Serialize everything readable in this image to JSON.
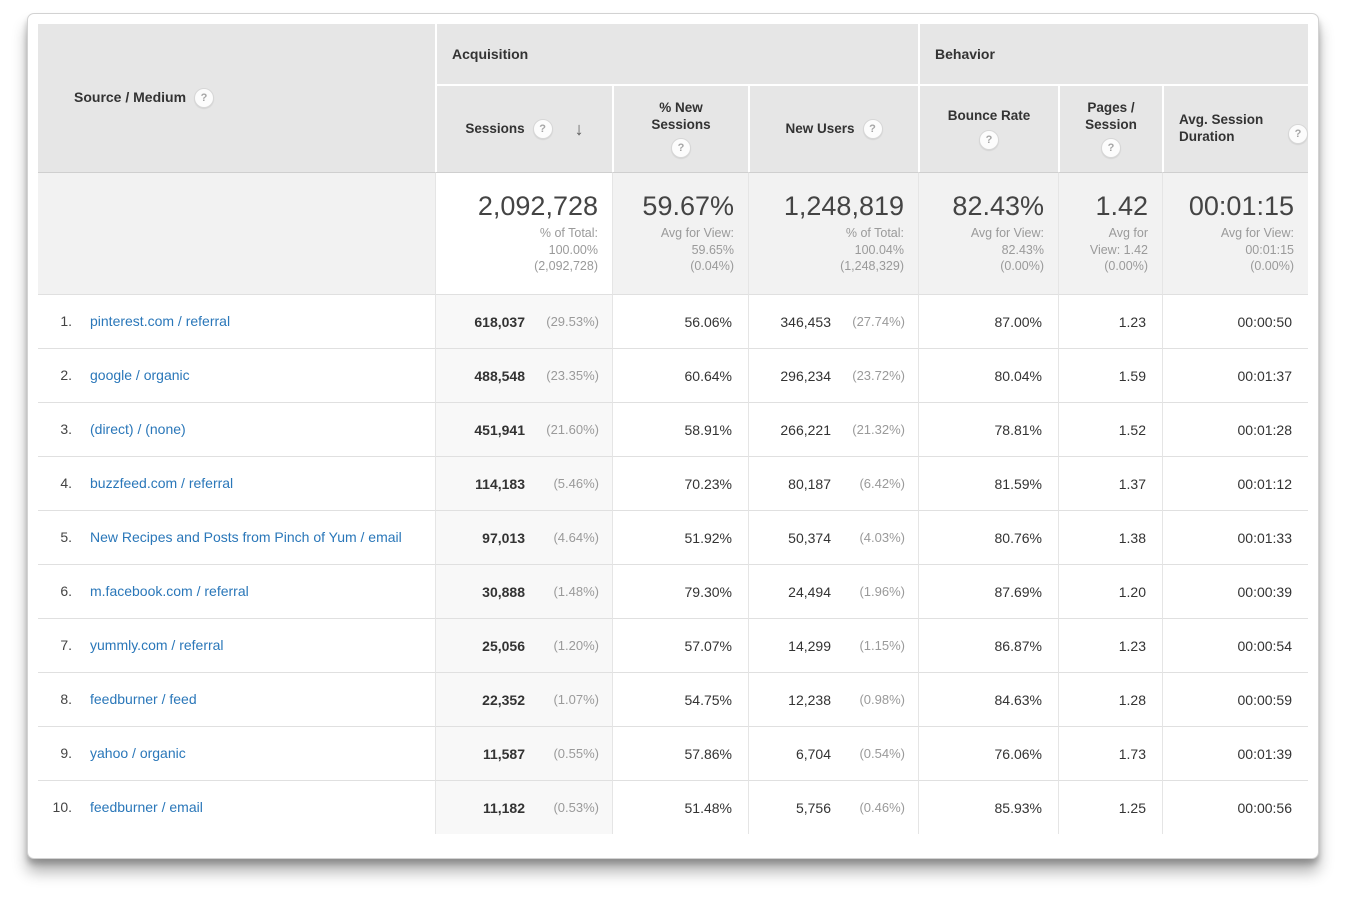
{
  "header": {
    "row_dimension": {
      "label": "Source / Medium"
    },
    "groups": [
      {
        "label": "Acquisition"
      },
      {
        "label": "Behavior"
      }
    ],
    "columns": [
      {
        "label": "Sessions",
        "sorted": "descending"
      },
      {
        "label": "% New Sessions"
      },
      {
        "label": "New Users"
      },
      {
        "label": "Bounce Rate"
      },
      {
        "label": "Pages / Session"
      },
      {
        "label": "Avg. Session Duration"
      }
    ]
  },
  "icons": {
    "help": "?",
    "sort_desc": "↓"
  },
  "summary": [
    {
      "value": "2,092,728",
      "sub": [
        "% of Total:",
        "100.00%",
        "(2,092,728)"
      ]
    },
    {
      "value": "59.67%",
      "sub": [
        "Avg for View:",
        "59.65%",
        "(0.04%)"
      ]
    },
    {
      "value": "1,248,819",
      "sub": [
        "% of Total:",
        "100.04%",
        "(1,248,329)"
      ]
    },
    {
      "value": "82.43%",
      "sub": [
        "Avg for View:",
        "82.43%",
        "(0.00%)"
      ]
    },
    {
      "value": "1.42",
      "sub": [
        "Avg for",
        "View: 1.42",
        "(0.00%)"
      ]
    },
    {
      "value": "00:01:15",
      "sub": [
        "Avg for View:",
        "00:01:15",
        "(0.00%)"
      ]
    }
  ],
  "rows": [
    {
      "rank": "1.",
      "source": "pinterest.com / referral",
      "sessions": "618,037",
      "sessions_pct": "(29.53%)",
      "new_sessions_pct": "56.06%",
      "new_users": "346,453",
      "new_users_pct": "(27.74%)",
      "bounce_rate": "87.00%",
      "pages_session": "1.23",
      "avg_duration": "00:00:50"
    },
    {
      "rank": "2.",
      "source": "google / organic",
      "sessions": "488,548",
      "sessions_pct": "(23.35%)",
      "new_sessions_pct": "60.64%",
      "new_users": "296,234",
      "new_users_pct": "(23.72%)",
      "bounce_rate": "80.04%",
      "pages_session": "1.59",
      "avg_duration": "00:01:37"
    },
    {
      "rank": "3.",
      "source": "(direct) / (none)",
      "sessions": "451,941",
      "sessions_pct": "(21.60%)",
      "new_sessions_pct": "58.91%",
      "new_users": "266,221",
      "new_users_pct": "(21.32%)",
      "bounce_rate": "78.81%",
      "pages_session": "1.52",
      "avg_duration": "00:01:28"
    },
    {
      "rank": "4.",
      "source": "buzzfeed.com / referral",
      "sessions": "114,183",
      "sessions_pct": "(5.46%)",
      "new_sessions_pct": "70.23%",
      "new_users": "80,187",
      "new_users_pct": "(6.42%)",
      "bounce_rate": "81.59%",
      "pages_session": "1.37",
      "avg_duration": "00:01:12"
    },
    {
      "rank": "5.",
      "source": "New Recipes and Posts from Pinch of Yum / email",
      "sessions": "97,013",
      "sessions_pct": "(4.64%)",
      "new_sessions_pct": "51.92%",
      "new_users": "50,374",
      "new_users_pct": "(4.03%)",
      "bounce_rate": "80.76%",
      "pages_session": "1.38",
      "avg_duration": "00:01:33"
    },
    {
      "rank": "6.",
      "source": "m.facebook.com / referral",
      "sessions": "30,888",
      "sessions_pct": "(1.48%)",
      "new_sessions_pct": "79.30%",
      "new_users": "24,494",
      "new_users_pct": "(1.96%)",
      "bounce_rate": "87.69%",
      "pages_session": "1.20",
      "avg_duration": "00:00:39"
    },
    {
      "rank": "7.",
      "source": "yummly.com / referral",
      "sessions": "25,056",
      "sessions_pct": "(1.20%)",
      "new_sessions_pct": "57.07%",
      "new_users": "14,299",
      "new_users_pct": "(1.15%)",
      "bounce_rate": "86.87%",
      "pages_session": "1.23",
      "avg_duration": "00:00:54"
    },
    {
      "rank": "8.",
      "source": "feedburner / feed",
      "sessions": "22,352",
      "sessions_pct": "(1.07%)",
      "new_sessions_pct": "54.75%",
      "new_users": "12,238",
      "new_users_pct": "(0.98%)",
      "bounce_rate": "84.63%",
      "pages_session": "1.28",
      "avg_duration": "00:00:59"
    },
    {
      "rank": "9.",
      "source": "yahoo / organic",
      "sessions": "11,587",
      "sessions_pct": "(0.55%)",
      "new_sessions_pct": "57.86%",
      "new_users": "6,704",
      "new_users_pct": "(0.54%)",
      "bounce_rate": "76.06%",
      "pages_session": "1.73",
      "avg_duration": "00:01:39"
    },
    {
      "rank": "10.",
      "source": "feedburner / email",
      "sessions": "11,182",
      "sessions_pct": "(0.53%)",
      "new_sessions_pct": "51.48%",
      "new_users": "5,756",
      "new_users_pct": "(0.46%)",
      "bounce_rate": "85.93%",
      "pages_session": "1.25",
      "avg_duration": "00:00:56"
    }
  ],
  "colors": {
    "link": "#2a77b9",
    "header_bg": "#e6e6e6",
    "summary_bg": "#f2f2f2",
    "sorted_col_bg": "#f8f8f8",
    "text": "#333333",
    "muted": "#9a9a9a"
  }
}
